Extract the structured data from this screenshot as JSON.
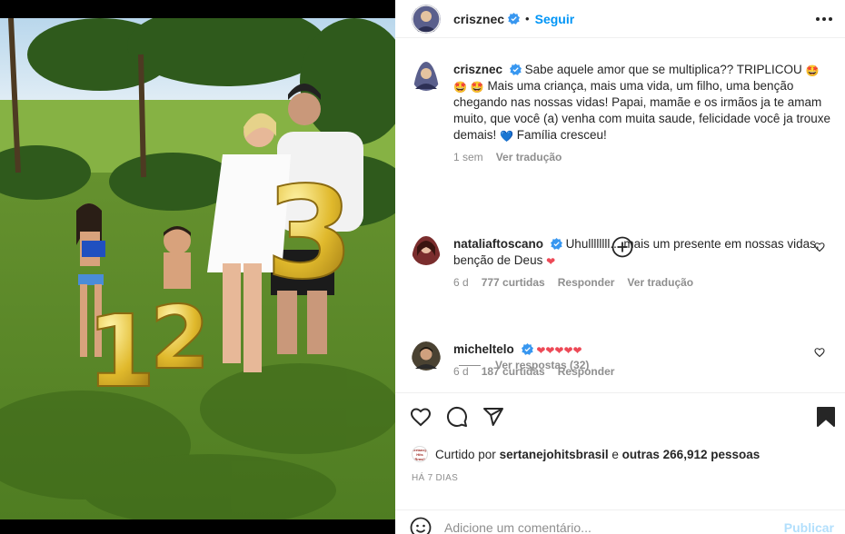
{
  "post": {
    "author": "crisznec",
    "follow_label": "Seguir",
    "dot": "•",
    "more_icon": "more-options-icon"
  },
  "caption": {
    "username": "crisznec",
    "text_part1": "Sabe aquele amor que se multiplica?? TRIPLICOU",
    "text_part2": "Mais uma criança, mais uma vida, um filho, uma benção chegando nas nossas vidas! Papai, mamãe e os irmãos ja te amam muito, que você (a) venha com muita saude, felicidade você ja trouxe demais!",
    "text_part3": "Família cresceu!",
    "time": "1 sem",
    "translate": "Ver tradução"
  },
  "comments": [
    {
      "username": "nataliaftoscano",
      "text": "Uhullllllll... mais um presente em nossas vidas, benção de Deus",
      "time": "6 d",
      "likes": "777 curtidas",
      "reply": "Responder",
      "translate": "Ver tradução",
      "view_replies": "Ver respostas (32)"
    },
    {
      "username": "micheltelo",
      "text": "",
      "time": "6 d",
      "likes": "187 curtidas",
      "reply": "Responder"
    }
  ],
  "likes": {
    "prefix": "Curtido por",
    "user": "sertanejohitsbrasil",
    "middle": "e",
    "others": "outras 266,912 pessoas",
    "mini_avatar_text": "Sertanejo Hits Brasil"
  },
  "date": "HÁ 7 DIAS",
  "add_comment": {
    "placeholder": "Adicione um comentário...",
    "publish": "Publicar"
  },
  "colors": {
    "accent": "#0095f6",
    "verified": "#3897f0",
    "heart_red": "#ed4956",
    "muted": "#8e8e8e",
    "publish_disabled": "#b2dffc"
  }
}
